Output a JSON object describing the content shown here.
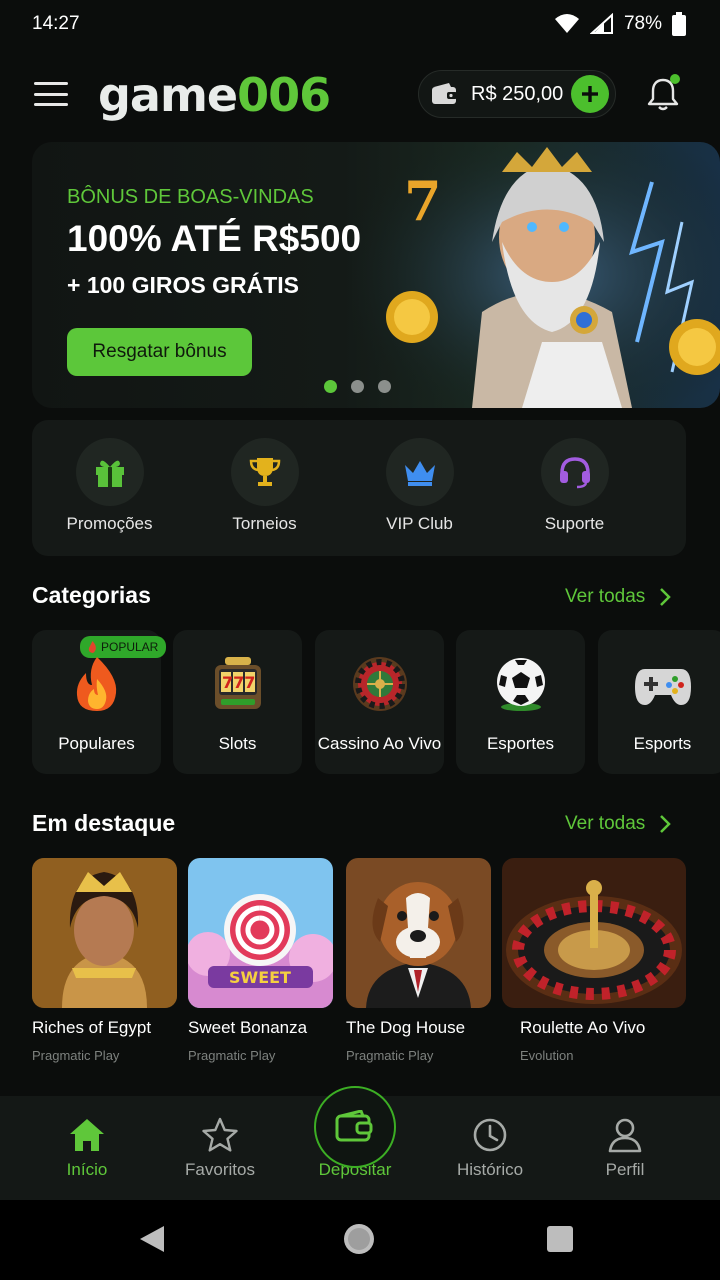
{
  "status_bar": {
    "time": "14:27",
    "battery": "78%"
  },
  "header": {
    "logo_part1": "game",
    "logo_part2": "006",
    "balance": "R$ 250,00"
  },
  "banner": {
    "eyebrow": "BÔNUS DE BOAS-VINDAS",
    "title": "100% ATÉ R$500",
    "subtitle": "+ 100 GIROS GRÁTIS",
    "cta": "Resgatar bônus",
    "slide_count": 3,
    "active_slide": 1
  },
  "quick_links": [
    {
      "label": "Promoções",
      "icon": "gift-icon"
    },
    {
      "label": "Torneios",
      "icon": "trophy-icon"
    },
    {
      "label": "VIP Club",
      "icon": "crown-icon"
    },
    {
      "label": "Suporte",
      "icon": "headset-icon"
    }
  ],
  "categories": {
    "title": "Categorias",
    "see_all": "Ver todas",
    "items": [
      {
        "label": "Populares",
        "icon": "fire-icon",
        "badge": "POPULAR"
      },
      {
        "label": "Slots",
        "icon": "slot-machine-icon"
      },
      {
        "label": "Cassino Ao Vivo",
        "icon": "roulette-wheel-icon"
      },
      {
        "label": "Esportes",
        "icon": "soccer-ball-icon"
      },
      {
        "label": "Esports",
        "icon": "gamepad-icon"
      }
    ]
  },
  "featured": {
    "title": "Em destaque",
    "see_all": "Ver todas",
    "games": [
      {
        "title": "Riches of Egypt",
        "provider": "Pragmatic Play"
      },
      {
        "title": "Sweet Bonanza",
        "provider": "Pragmatic Play"
      },
      {
        "title": "The Dog House",
        "provider": "Pragmatic Play"
      },
      {
        "title": "Roulette Ao Vivo",
        "provider": "Evolution"
      }
    ]
  },
  "bottom_nav": [
    {
      "label": "Início",
      "icon": "home-icon",
      "active": true
    },
    {
      "label": "Favoritos",
      "icon": "star-icon"
    },
    {
      "label": "Depositar",
      "icon": "wallet-icon"
    },
    {
      "label": "Histórico",
      "icon": "clock-icon"
    },
    {
      "label": "Perfil",
      "icon": "user-icon"
    }
  ],
  "colors": {
    "accent": "#5fc73a",
    "background": "#0b0d0c",
    "card": "#151917"
  }
}
